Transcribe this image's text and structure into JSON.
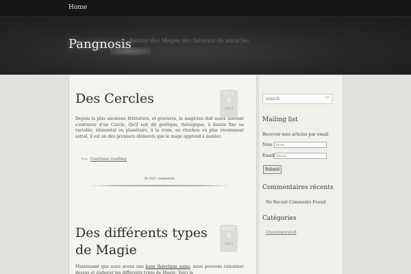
{
  "nav": {
    "home_label": "Home"
  },
  "header": {
    "site_title": "Pangnosis",
    "tagline": "Retour des Mages des faiseurs de miracles"
  },
  "posts": [
    {
      "title": "Des Cercles",
      "date": {
        "month": "OCT",
        "day": "9",
        "year": "2013"
      },
      "excerpt": "Depuis la plus ancienne littérature, et gravures, le magicien doit assez souvent s'entourer d'un Cercle. Qu'il soit dit goétique, théurgique, à dessin fixe ou variable, élémental ou planétaire, à la craie, au charbon ou plus récemment astral, il est un des premiers éléments que le mage apprend à manier.",
      "continue_label": "Continue reading",
      "comments_label": "30 025 comments"
    },
    {
      "title": "Des différents types de Magie",
      "date": {
        "month": "SEPT",
        "day": "8",
        "year": "2013"
      },
      "excerpt_before": "Maintenant que nous avons une ",
      "excerpt_link": "base théorique saine",
      "excerpt_after": ", nous pouvons raisonner dessus et élaborer les différents types de Magie. Voici la"
    }
  ],
  "sidebar": {
    "search_placeholder": "search",
    "search_go": "go",
    "mailing_title": "Mailing list",
    "mailing_desc": "Recevoir mes articles par email",
    "nom_label": "Nom",
    "nom_placeholder": "Nom",
    "email_label": "Email",
    "email_placeholder": "Email",
    "submit_label": "Submit",
    "recent_comments_title": "Commentaires récents",
    "no_comments": "No Recent Comments Found",
    "categories_title": "Catégories",
    "category_uncategorized": "Uncategorized"
  }
}
